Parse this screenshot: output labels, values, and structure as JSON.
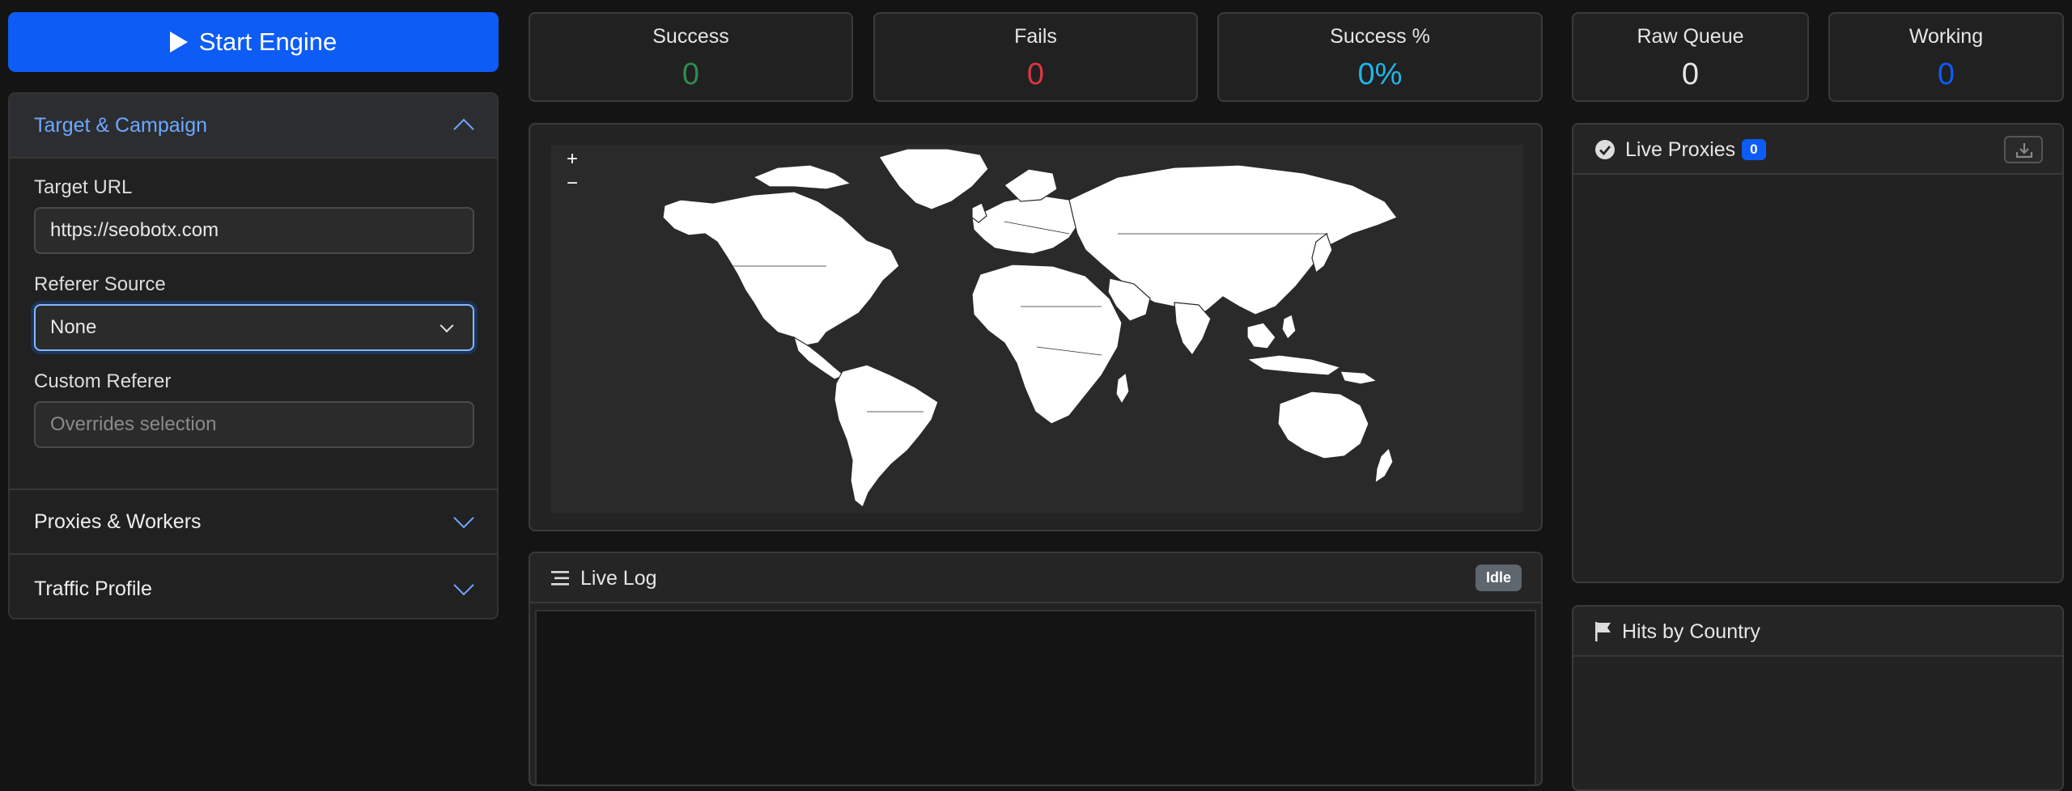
{
  "sidebar": {
    "start_button_label": "Start Engine",
    "sections": [
      {
        "title": "Target & Campaign",
        "expanded": true
      },
      {
        "title": "Proxies & Workers",
        "expanded": false
      },
      {
        "title": "Traffic Profile",
        "expanded": false
      }
    ],
    "target_url": {
      "label": "Target URL",
      "value": "https://seobotx.com"
    },
    "referer_source": {
      "label": "Referer Source",
      "selected": "None"
    },
    "custom_referer": {
      "label": "Custom Referer",
      "placeholder": "Overrides selection"
    }
  },
  "stats": [
    {
      "label": "Success",
      "value": "0",
      "color": "#2e8b4f"
    },
    {
      "label": "Fails",
      "value": "0",
      "color": "#dc3545"
    },
    {
      "label": "Success %",
      "value": "0%",
      "color": "#1fb6e8"
    },
    {
      "label": "Raw Queue",
      "value": "0",
      "color": "#e6e6e6"
    },
    {
      "label": "Working",
      "value": "0",
      "color": "#0d5cf5"
    }
  ],
  "map": {
    "zoom_in": "+",
    "zoom_out": "−"
  },
  "live_log": {
    "title": "Live Log",
    "status": "Idle"
  },
  "live_proxies": {
    "title": "Live Proxies",
    "count": "0"
  },
  "hits_by_country": {
    "title": "Hits by Country"
  },
  "colors": {
    "accent": "#0d5cf5",
    "accent_light": "#6ea8fe",
    "panel": "#222222",
    "background": "#141414"
  }
}
